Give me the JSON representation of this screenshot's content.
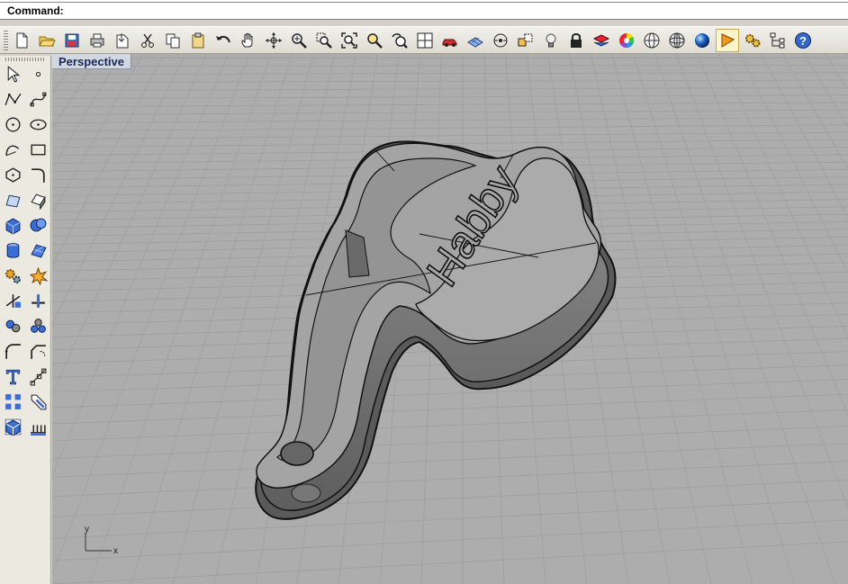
{
  "command": {
    "label": "Command:",
    "value": ""
  },
  "main_toolbar": {
    "buttons": [
      {
        "icon": "new-document-icon"
      },
      {
        "icon": "open-folder-icon"
      },
      {
        "icon": "save-icon"
      },
      {
        "icon": "print-icon"
      },
      {
        "icon": "import-icon"
      },
      {
        "icon": "cut-icon"
      },
      {
        "icon": "copy-icon"
      },
      {
        "icon": "paste-icon"
      },
      {
        "icon": "undo-icon"
      },
      {
        "icon": "pan-hand-icon"
      },
      {
        "icon": "rotate-view-icon"
      },
      {
        "icon": "zoom-dynamic-icon"
      },
      {
        "icon": "zoom-window-icon"
      },
      {
        "icon": "zoom-extents-icon"
      },
      {
        "icon": "zoom-selected-icon"
      },
      {
        "icon": "undo-view-icon"
      },
      {
        "icon": "four-viewports-icon"
      },
      {
        "icon": "camera-car-icon"
      },
      {
        "icon": "construction-plane-icon"
      },
      {
        "icon": "object-snap-icon"
      },
      {
        "icon": "select-filter-icon"
      },
      {
        "icon": "light-bulb-icon"
      },
      {
        "icon": "lock-icon"
      },
      {
        "icon": "layer-icon"
      },
      {
        "icon": "color-wheel-icon"
      },
      {
        "icon": "wireframe-sphere-icon"
      },
      {
        "icon": "shaded-sphere-icon"
      },
      {
        "icon": "rendered-sphere-icon"
      },
      {
        "icon": "render-icon"
      },
      {
        "icon": "options-gears-icon"
      },
      {
        "icon": "hierarchy-icon"
      },
      {
        "icon": "help-icon"
      }
    ],
    "active_index": 28
  },
  "left_toolbar": {
    "buttons": [
      {
        "icon": "select-arrow-icon"
      },
      {
        "icon": "point-icon"
      },
      {
        "icon": "polyline-icon"
      },
      {
        "icon": "curve-icon"
      },
      {
        "icon": "circle-icon"
      },
      {
        "icon": "ellipse-icon"
      },
      {
        "icon": "arc-icon"
      },
      {
        "icon": "rectangle-icon"
      },
      {
        "icon": "polygon-icon"
      },
      {
        "icon": "fillet-curve-icon"
      },
      {
        "icon": "surface-from-points-icon"
      },
      {
        "icon": "extrude-surface-icon"
      },
      {
        "icon": "box-solid-icon"
      },
      {
        "icon": "boolean-union-icon"
      },
      {
        "icon": "cylinder-icon"
      },
      {
        "icon": "mesh-icon"
      },
      {
        "icon": "transform-gears-icon"
      },
      {
        "icon": "explode-icon"
      },
      {
        "icon": "trim-icon"
      },
      {
        "icon": "split-icon"
      },
      {
        "icon": "group-icon"
      },
      {
        "icon": "ungroup-icon"
      },
      {
        "icon": "fillet-edge-icon"
      },
      {
        "icon": "chamfer-icon"
      },
      {
        "icon": "text-icon"
      },
      {
        "icon": "dimension-icon"
      },
      {
        "icon": "array-icon"
      },
      {
        "icon": "analyze-icon"
      },
      {
        "icon": "render-mesh-icon"
      },
      {
        "icon": "dimension-linear-icon"
      }
    ]
  },
  "viewport": {
    "title": "Perspective",
    "model_text": "Habby",
    "axis": {
      "x": "x",
      "y": "y"
    }
  },
  "colors": {
    "viewport_bg": "#adadad",
    "grid": "#9c9c9c",
    "model_fill": "#9a9a9a",
    "model_edge": "#111111",
    "accent": "#1a2a56"
  }
}
